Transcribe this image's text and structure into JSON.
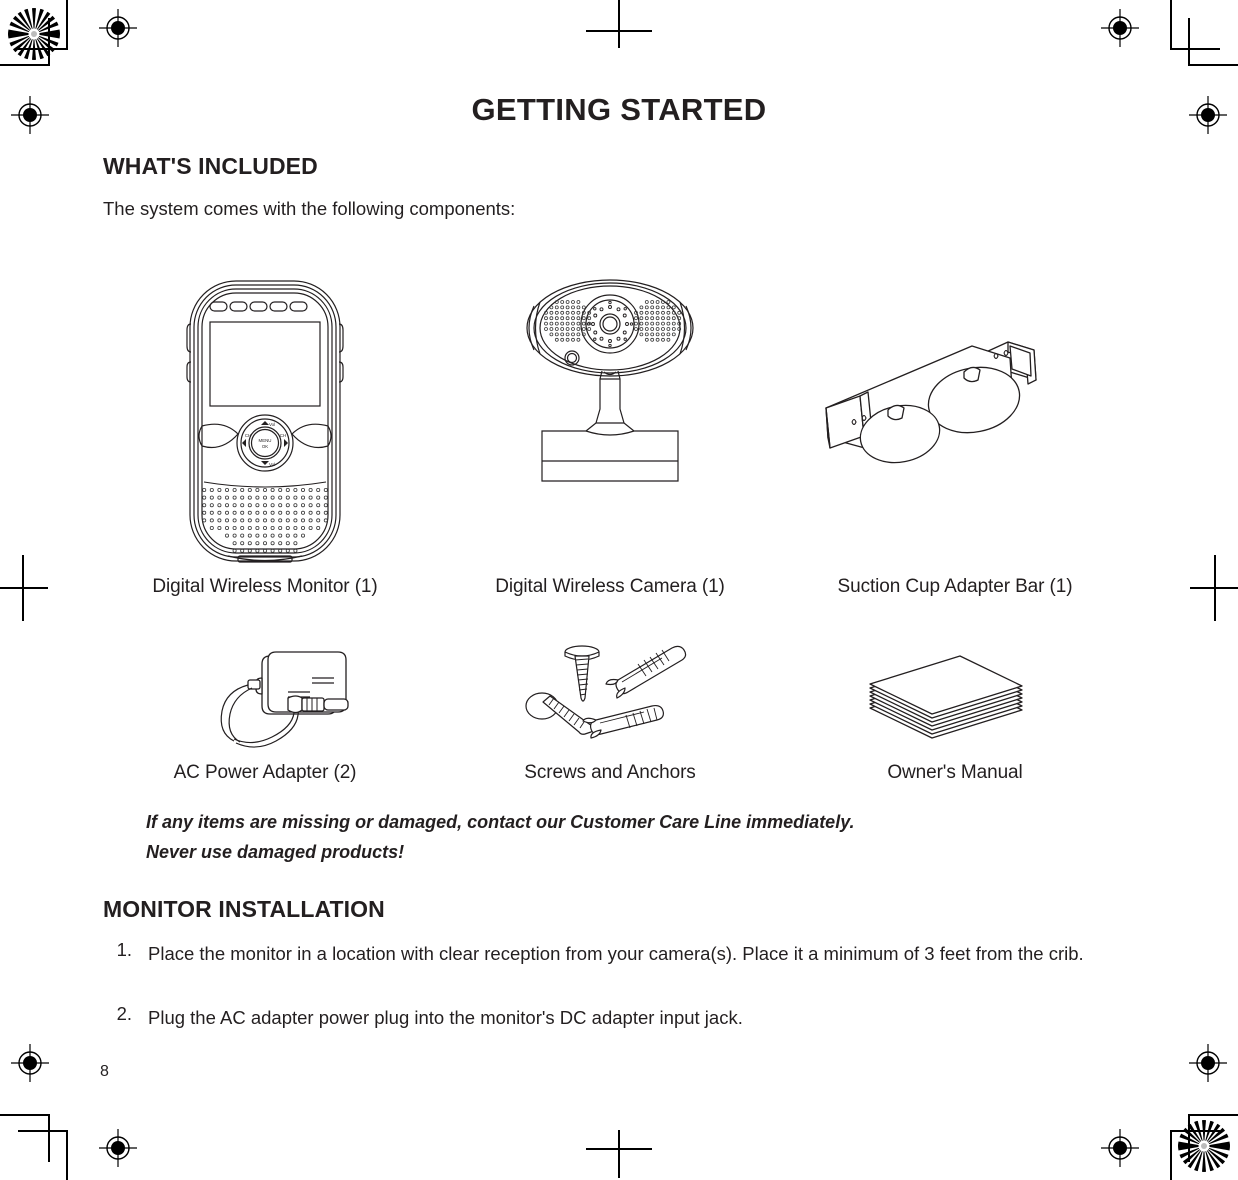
{
  "document": {
    "page_title": "GETTING STARTED",
    "page_number": "8"
  },
  "whats_included": {
    "heading": "WHAT'S INCLUDED",
    "intro": "The system comes with the following components:",
    "items": [
      {
        "caption": "Digital Wireless Monitor (1)",
        "icon": "digital-wireless-monitor-illustration"
      },
      {
        "caption": "Digital Wireless Camera (1)",
        "icon": "digital-wireless-camera-illustration"
      },
      {
        "caption": "Suction Cup Adapter Bar (1)",
        "icon": "suction-cup-adapter-bar-illustration"
      },
      {
        "caption": "AC Power Adapter (2)",
        "icon": "ac-power-adapter-illustration"
      },
      {
        "caption": "Screws and Anchors",
        "icon": "screws-and-anchors-illustration"
      },
      {
        "caption": "Owner's Manual",
        "icon": "owners-manual-illustration"
      }
    ],
    "warning_line1": "If any items are missing or damaged, contact our Customer Care Line immediately.",
    "warning_line2": "Never use damaged products!"
  },
  "monitor_installation": {
    "heading": "MONITOR INSTALLATION",
    "steps": [
      {
        "number": "1.",
        "text": "Place the monitor in a location with clear reception from your camera(s). Place it a minimum of 3 feet from the crib."
      },
      {
        "number": "2.",
        "text": "Plug the AC adapter power plug into the monitor's DC adapter input jack."
      }
    ]
  },
  "monitor_device": {
    "nav_center_line1": "MENU",
    "nav_center_line2": "OK",
    "nav_left": "CH",
    "nav_right": "CH"
  },
  "colors": {
    "ink": "#231f20",
    "line": "#231f20",
    "paper": "#ffffff"
  }
}
